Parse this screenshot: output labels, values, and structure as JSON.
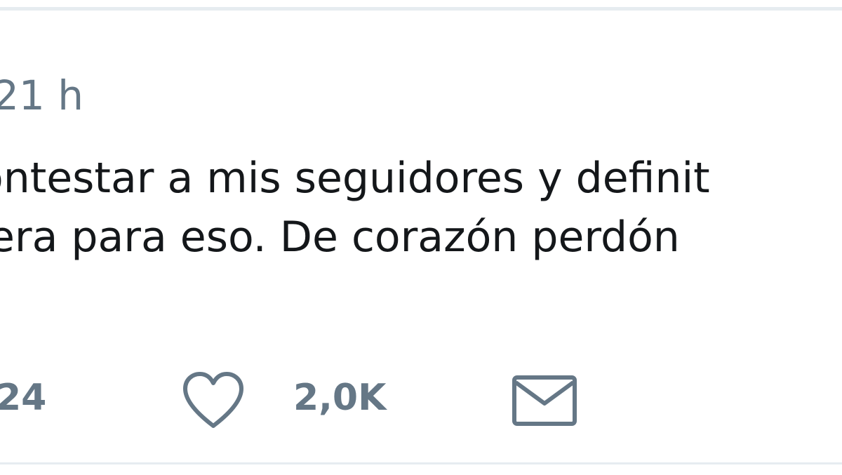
{
  "tweet": {
    "timestamp": "21 h",
    "text_line1": "ontestar a mis seguidores y definit",
    "text_line2": "era para eso. De corazón perdón",
    "actions": {
      "reply_count": "24",
      "like_count": "2,0K"
    }
  },
  "icons": {
    "like": "heart-icon",
    "direct_message": "envelope-icon"
  },
  "colors": {
    "text": "#14171a",
    "muted": "#657786",
    "divider": "#e6ecf0"
  }
}
